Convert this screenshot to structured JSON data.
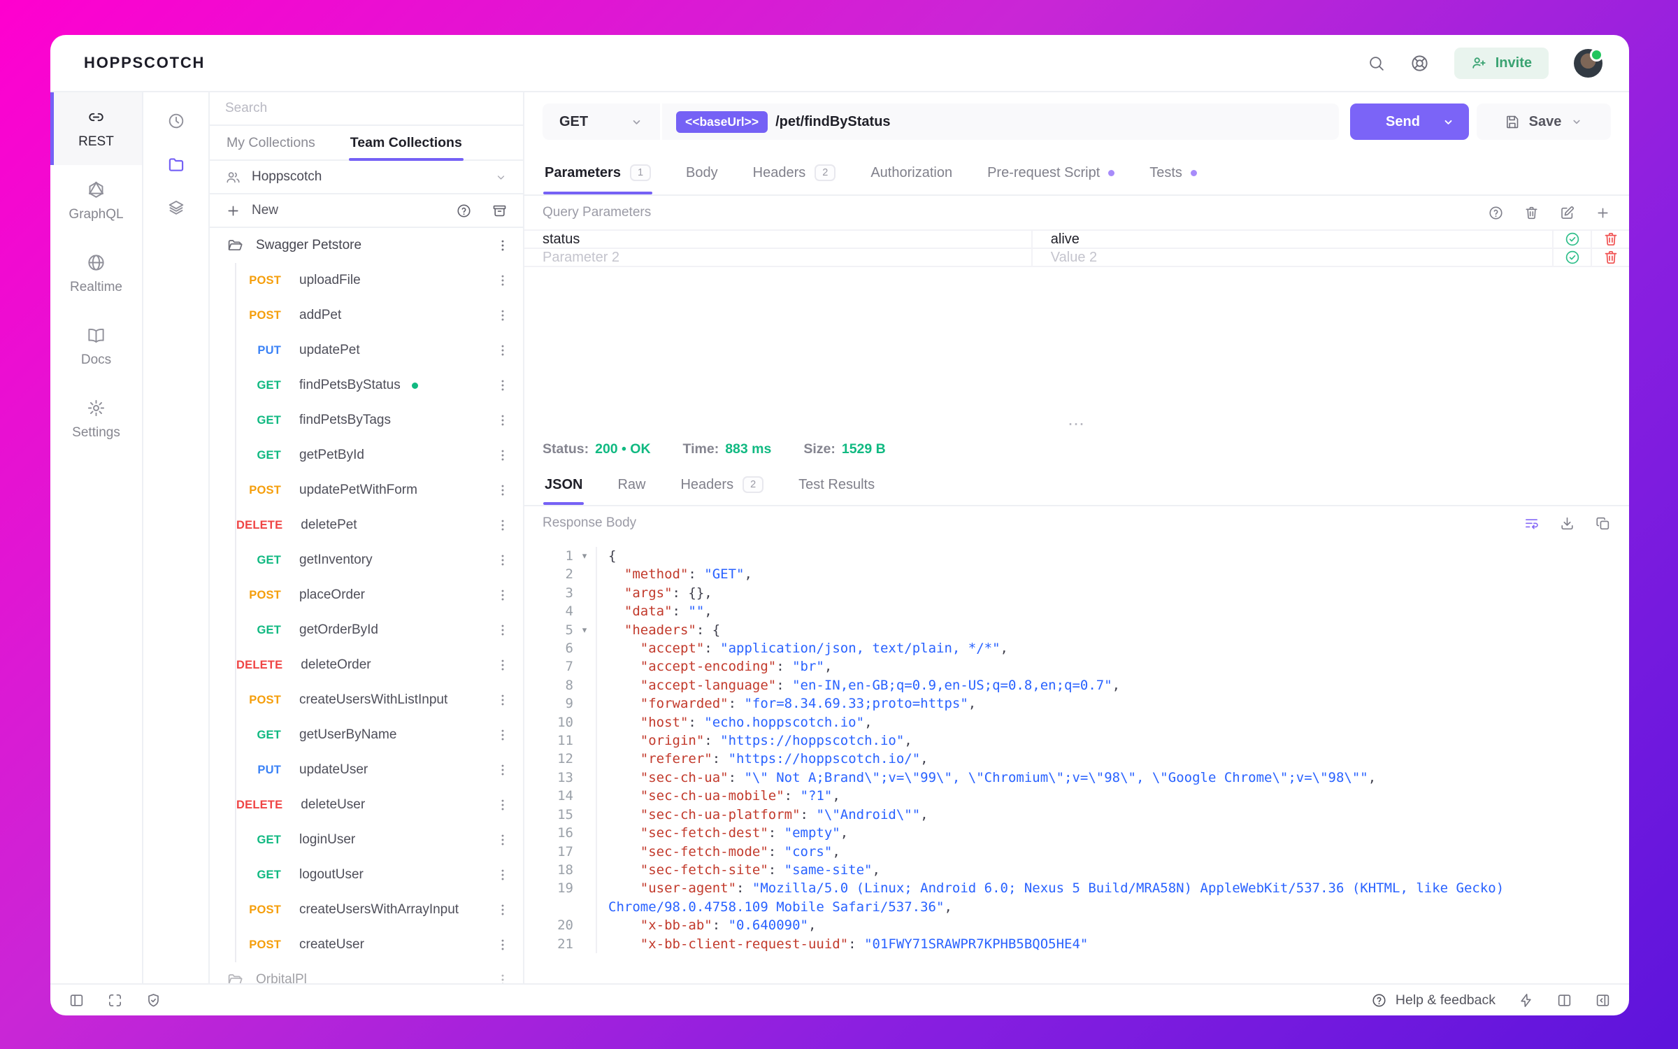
{
  "header": {
    "logo": "HOPPSCOTCH",
    "invite_label": "Invite"
  },
  "left_nav": {
    "items": [
      {
        "id": "rest",
        "icon": "link",
        "label": "REST",
        "active": true
      },
      {
        "id": "graphql",
        "icon": "graphql",
        "label": "GraphQL"
      },
      {
        "id": "realtime",
        "icon": "globe",
        "label": "Realtime"
      },
      {
        "id": "docs",
        "icon": "book",
        "label": "Docs"
      },
      {
        "id": "settings",
        "icon": "gear",
        "label": "Settings"
      }
    ]
  },
  "rail": {
    "items": [
      {
        "id": "history",
        "icon": "clock"
      },
      {
        "id": "collections",
        "icon": "folder",
        "active": true
      },
      {
        "id": "environments",
        "icon": "layers"
      }
    ]
  },
  "collections": {
    "search_placeholder": "Search",
    "tabs": [
      {
        "id": "my",
        "label": "My Collections"
      },
      {
        "id": "team",
        "label": "Team Collections",
        "active": true
      }
    ],
    "team_name": "Hoppscotch",
    "new_label": "New",
    "collection_name": "Swagger Petstore",
    "requests": [
      {
        "method": "POST",
        "name": "uploadFile"
      },
      {
        "method": "POST",
        "name": "addPet"
      },
      {
        "method": "PUT",
        "name": "updatePet"
      },
      {
        "method": "GET",
        "name": "findPetsByStatus",
        "active": true
      },
      {
        "method": "GET",
        "name": "findPetsByTags"
      },
      {
        "method": "GET",
        "name": "getPetById"
      },
      {
        "method": "POST",
        "name": "updatePetWithForm"
      },
      {
        "method": "DELETE",
        "name": "deletePet"
      },
      {
        "method": "GET",
        "name": "getInventory"
      },
      {
        "method": "POST",
        "name": "placeOrder"
      },
      {
        "method": "GET",
        "name": "getOrderById"
      },
      {
        "method": "DELETE",
        "name": "deleteOrder"
      },
      {
        "method": "POST",
        "name": "createUsersWithListInput"
      },
      {
        "method": "GET",
        "name": "getUserByName"
      },
      {
        "method": "PUT",
        "name": "updateUser"
      },
      {
        "method": "DELETE",
        "name": "deleteUser"
      },
      {
        "method": "GET",
        "name": "loginUser"
      },
      {
        "method": "GET",
        "name": "logoutUser"
      },
      {
        "method": "POST",
        "name": "createUsersWithArrayInput"
      },
      {
        "method": "POST",
        "name": "createUser"
      }
    ],
    "partial_collection_name": "OrbitalPl"
  },
  "request": {
    "method": "GET",
    "base_url_chip": "<<baseUrl>>",
    "path": "/pet/findByStatus",
    "send_label": "Send",
    "save_label": "Save",
    "tabs": [
      {
        "label": "Parameters",
        "badge": "1",
        "active": true
      },
      {
        "label": "Body"
      },
      {
        "label": "Headers",
        "badge": "2"
      },
      {
        "label": "Authorization"
      },
      {
        "label": "Pre-request Script",
        "dot": true
      },
      {
        "label": "Tests",
        "dot": true
      }
    ],
    "section_title": "Query Parameters",
    "params": [
      {
        "key": "status",
        "value": "alive"
      },
      {
        "key": "Parameter 2",
        "value": "Value 2",
        "placeholder": true
      }
    ]
  },
  "response": {
    "status_label": "Status:",
    "status_value": "200 • OK",
    "time_label": "Time:",
    "time_value": "883 ms",
    "size_label": "Size:",
    "size_value": "1529 B",
    "tabs": [
      {
        "label": "JSON",
        "active": true
      },
      {
        "label": "Raw"
      },
      {
        "label": "Headers",
        "badge": "2"
      },
      {
        "label": "Test Results"
      }
    ],
    "body_label": "Response Body",
    "code": [
      {
        "n": "1",
        "f": true,
        "seg": [
          [
            "p",
            "{"
          ]
        ]
      },
      {
        "n": "2",
        "seg": [
          [
            "k",
            "  \"method\""
          ],
          [
            "p",
            ": "
          ],
          [
            "s",
            "\"GET\""
          ],
          [
            "p",
            ","
          ]
        ]
      },
      {
        "n": "3",
        "seg": [
          [
            "k",
            "  \"args\""
          ],
          [
            "p",
            ": {},"
          ]
        ]
      },
      {
        "n": "4",
        "seg": [
          [
            "k",
            "  \"data\""
          ],
          [
            "p",
            ": "
          ],
          [
            "s",
            "\"\""
          ],
          [
            "p",
            ","
          ]
        ]
      },
      {
        "n": "5",
        "f": true,
        "seg": [
          [
            "k",
            "  \"headers\""
          ],
          [
            "p",
            ": {"
          ]
        ]
      },
      {
        "n": "6",
        "seg": [
          [
            "k",
            "    \"accept\""
          ],
          [
            "p",
            ": "
          ],
          [
            "s",
            "\"application/json, text/plain, */*\""
          ],
          [
            "p",
            ","
          ]
        ]
      },
      {
        "n": "7",
        "seg": [
          [
            "k",
            "    \"accept-encoding\""
          ],
          [
            "p",
            ": "
          ],
          [
            "s",
            "\"br\""
          ],
          [
            "p",
            ","
          ]
        ]
      },
      {
        "n": "8",
        "seg": [
          [
            "k",
            "    \"accept-language\""
          ],
          [
            "p",
            ": "
          ],
          [
            "s",
            "\"en-IN,en-GB;q=0.9,en-US;q=0.8,en;q=0.7\""
          ],
          [
            "p",
            ","
          ]
        ]
      },
      {
        "n": "9",
        "seg": [
          [
            "k",
            "    \"forwarded\""
          ],
          [
            "p",
            ": "
          ],
          [
            "s",
            "\"for=8.34.69.33;proto=https\""
          ],
          [
            "p",
            ","
          ]
        ]
      },
      {
        "n": "10",
        "seg": [
          [
            "k",
            "    \"host\""
          ],
          [
            "p",
            ": "
          ],
          [
            "s",
            "\"echo.hoppscotch.io\""
          ],
          [
            "p",
            ","
          ]
        ]
      },
      {
        "n": "11",
        "seg": [
          [
            "k",
            "    \"origin\""
          ],
          [
            "p",
            ": "
          ],
          [
            "s",
            "\"https://hoppscotch.io\""
          ],
          [
            "p",
            ","
          ]
        ]
      },
      {
        "n": "12",
        "seg": [
          [
            "k",
            "    \"referer\""
          ],
          [
            "p",
            ": "
          ],
          [
            "s",
            "\"https://hoppscotch.io/\""
          ],
          [
            "p",
            ","
          ]
        ]
      },
      {
        "n": "13",
        "seg": [
          [
            "k",
            "    \"sec-ch-ua\""
          ],
          [
            "p",
            ": "
          ],
          [
            "s",
            "\"\\\" Not A;Brand\\\";v=\\\"99\\\", \\\"Chromium\\\";v=\\\"98\\\", \\\"Google Chrome\\\";v=\\\"98\\\"\""
          ],
          [
            "p",
            ","
          ]
        ]
      },
      {
        "n": "14",
        "seg": [
          [
            "k",
            "    \"sec-ch-ua-mobile\""
          ],
          [
            "p",
            ": "
          ],
          [
            "s",
            "\"?1\""
          ],
          [
            "p",
            ","
          ]
        ]
      },
      {
        "n": "15",
        "seg": [
          [
            "k",
            "    \"sec-ch-ua-platform\""
          ],
          [
            "p",
            ": "
          ],
          [
            "s",
            "\"\\\"Android\\\"\""
          ],
          [
            "p",
            ","
          ]
        ]
      },
      {
        "n": "16",
        "seg": [
          [
            "k",
            "    \"sec-fetch-dest\""
          ],
          [
            "p",
            ": "
          ],
          [
            "s",
            "\"empty\""
          ],
          [
            "p",
            ","
          ]
        ]
      },
      {
        "n": "17",
        "seg": [
          [
            "k",
            "    \"sec-fetch-mode\""
          ],
          [
            "p",
            ": "
          ],
          [
            "s",
            "\"cors\""
          ],
          [
            "p",
            ","
          ]
        ]
      },
      {
        "n": "18",
        "seg": [
          [
            "k",
            "    \"sec-fetch-site\""
          ],
          [
            "p",
            ": "
          ],
          [
            "s",
            "\"same-site\""
          ],
          [
            "p",
            ","
          ]
        ]
      },
      {
        "n": "19",
        "seg": [
          [
            "k",
            "    \"user-agent\""
          ],
          [
            "p",
            ": "
          ],
          [
            "s",
            "\"Mozilla/5.0 (Linux; Android 6.0; Nexus 5 Build/MRA58N) AppleWebKit/537.36 (KHTML, like Gecko)"
          ]
        ]
      },
      {
        "seg": [
          [
            "s",
            "Chrome/98.0.4758.109 Mobile Safari/537.36\""
          ],
          [
            "p",
            ","
          ]
        ]
      },
      {
        "n": "20",
        "seg": [
          [
            "k",
            "    \"x-bb-ab\""
          ],
          [
            "p",
            ": "
          ],
          [
            "s",
            "\"0.640090\""
          ],
          [
            "p",
            ","
          ]
        ]
      },
      {
        "n": "21",
        "seg": [
          [
            "k",
            "    \"x-bb-client-request-uuid\""
          ],
          [
            "p",
            ": "
          ],
          [
            "s",
            "\"01FWY71SRAWPR7KPHB5BQO5HE4\""
          ]
        ]
      }
    ]
  },
  "footer": {
    "help_label": "Help & feedback"
  },
  "colors": {
    "accent": "#7561f5",
    "success": "#10b981",
    "danger": "#ef4444",
    "post": "#f59e0b",
    "put": "#3b82f6",
    "json_key": "#c23a2c",
    "json_string": "#2962ff"
  }
}
